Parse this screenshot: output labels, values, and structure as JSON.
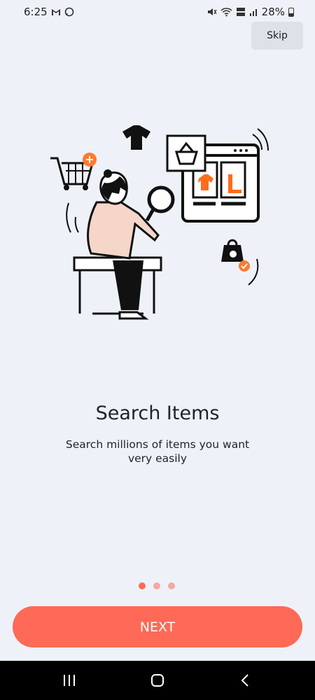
{
  "status": {
    "time": "6:25",
    "battery": "28%",
    "icons": [
      "gmail-icon",
      "whatsapp-icon",
      "mute-icon",
      "wifi-icon",
      "volte-lte-icon",
      "signal-icon",
      "battery-icon"
    ]
  },
  "header": {
    "skip_label": "Skip"
  },
  "content": {
    "title": "Search Items",
    "description": "Search millions of items you want very easily",
    "page_indicator": {
      "current": 1,
      "total": 3
    }
  },
  "footer": {
    "next_label": "NEXT"
  },
  "navigation": {
    "icons": [
      "recent-apps-icon",
      "home-icon",
      "back-icon"
    ]
  },
  "colors": {
    "accent": "#ff6957",
    "background": "#eef2f8",
    "text": "#20242a"
  }
}
